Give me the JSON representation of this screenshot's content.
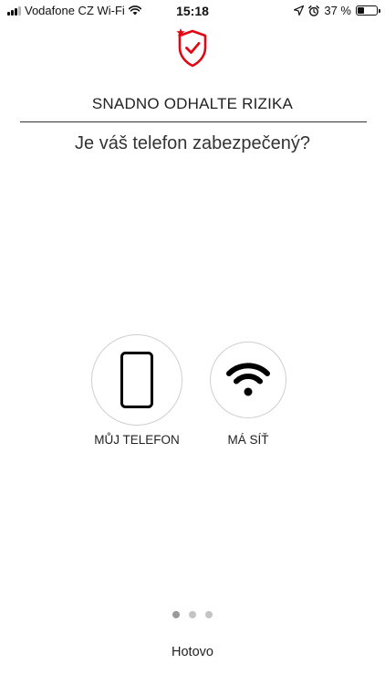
{
  "status_bar": {
    "carrier": "Vodafone CZ Wi-Fi",
    "time": "15:18",
    "battery_percent": "37 %",
    "battery_level": 0.37,
    "icons": [
      "signal-icon",
      "wifi-icon",
      "location-arrow-icon",
      "alarm-icon",
      "battery-icon"
    ]
  },
  "brand": {
    "logo_icon": "shield-check-icon",
    "accent_color": "#e30613"
  },
  "header": {
    "title": "SNADNO ODHALTE RIZIKA",
    "subtitle": "Je váš telefon zabezpečený?"
  },
  "options": [
    {
      "label": "MŮJ TELEFON",
      "icon": "smartphone-icon"
    },
    {
      "label": "MÁ SÍŤ",
      "icon": "wifi-icon"
    }
  ],
  "pager": {
    "pages": 3,
    "current": 1
  },
  "footer": {
    "done_label": "Hotovo"
  }
}
